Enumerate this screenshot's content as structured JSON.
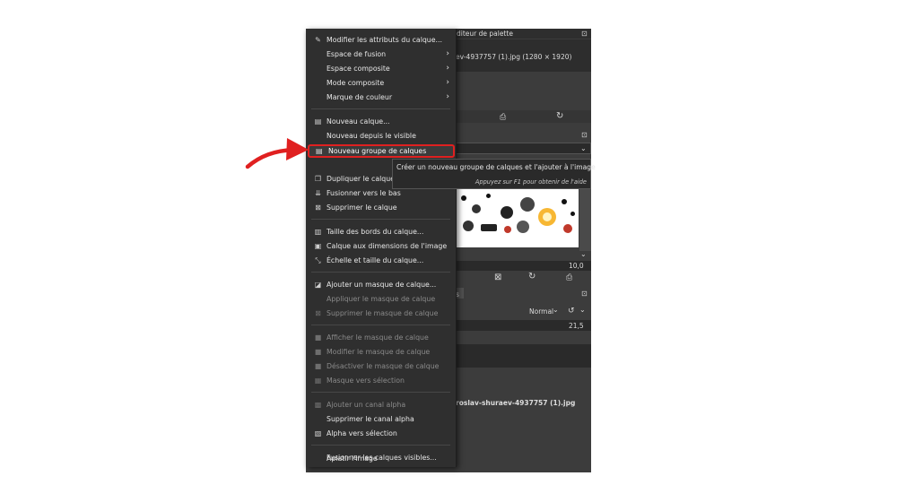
{
  "background_panel": {
    "palette_tab": "diteur de palette",
    "image_name": "ev-4937757 (1).jpg (1280 × 1920)",
    "spin_value_1": "10,0",
    "layer_mode": "Normal",
    "spin_value_2": "21,5",
    "layer_file": "roslav-shuraev-4937757 (1).jpg"
  },
  "menu": {
    "items": [
      {
        "label": "Modifier les attributs du calque...",
        "icon": "edit-icon"
      },
      {
        "label": "Espace de fusion"
      },
      {
        "label": "Espace composite"
      },
      {
        "label": "Mode composite"
      },
      {
        "label": "Marque de couleur"
      },
      {
        "label": "Nouveau calque...",
        "icon": "new-layer-icon"
      },
      {
        "label": "Nouveau depuis le visible"
      },
      {
        "label": "Nouveau groupe de calques",
        "icon": "layer-group-icon"
      },
      {
        "label": "Dupliquer le calque",
        "icon": "duplicate-icon"
      },
      {
        "label": "Fusionner vers le bas",
        "icon": "merge-down-icon"
      },
      {
        "label": "Supprimer le calque",
        "icon": "delete-icon"
      },
      {
        "label": "Taille des bords du calque...",
        "icon": "boundary-size-icon"
      },
      {
        "label": "Calque aux dimensions de l'image",
        "icon": "layer-to-image-icon"
      },
      {
        "label": "Échelle et taille du calque...",
        "icon": "scale-icon"
      },
      {
        "label": "Ajouter un masque de calque...",
        "icon": "add-mask-icon"
      },
      {
        "label": "Appliquer le masque de calque"
      },
      {
        "label": "Supprimer le masque de calque",
        "icon": "delete-icon"
      },
      {
        "label": "Afficher le masque de calque"
      },
      {
        "label": "Modifier le masque de calque"
      },
      {
        "label": "Désactiver le masque de calque"
      },
      {
        "label": "Masque vers sélection",
        "icon": "mask-selection-icon"
      },
      {
        "label": "Ajouter un canal alpha",
        "icon": "alpha-icon"
      },
      {
        "label": "Supprimer le canal alpha"
      },
      {
        "label": "Alpha vers sélection",
        "icon": "alpha-selection-icon"
      },
      {
        "label": "Fusionner les calques visibles..."
      },
      {
        "label": "Aplatir l'image"
      }
    ]
  },
  "tooltip": {
    "main": "Créer un nouveau groupe de calques et l'ajouter à l'image",
    "hint": "Appuyez sur F1 pour obtenir de l'aide"
  },
  "colors": {
    "highlight_border": "#e02020",
    "arrow": "#e02020",
    "menu_bg": "#2f2f2f",
    "panel_bg": "#3c3c3c"
  }
}
